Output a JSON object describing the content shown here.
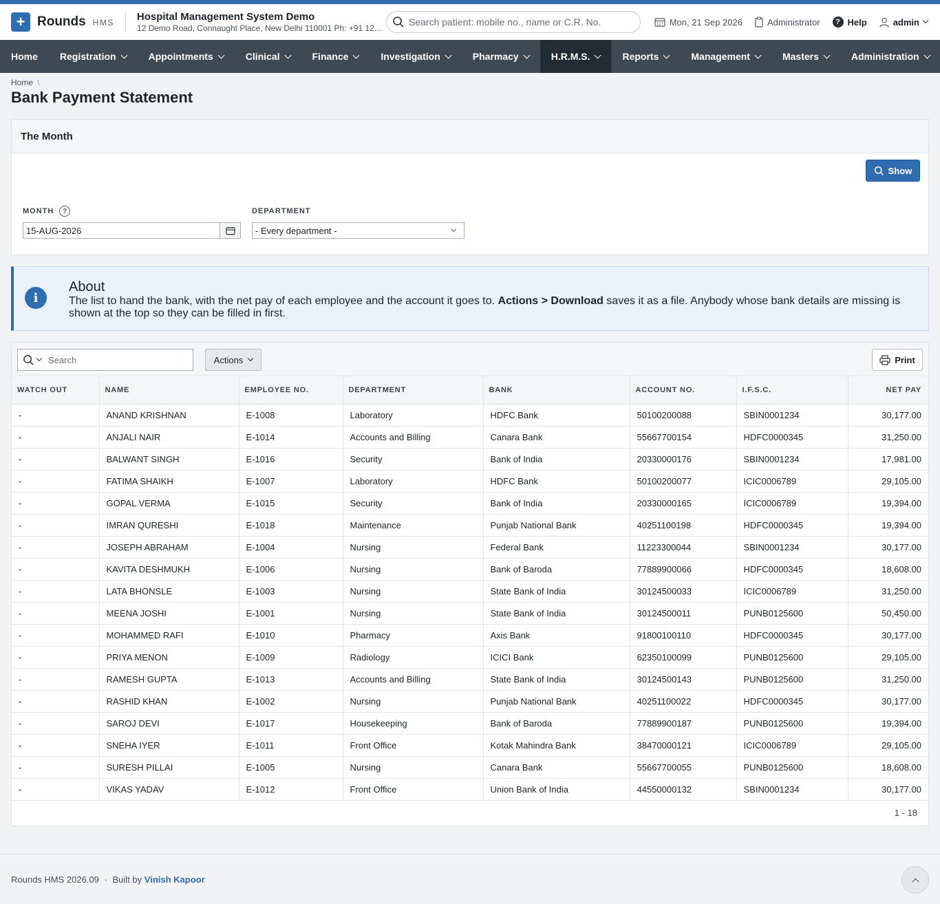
{
  "app": {
    "brand": "Rounds",
    "brand_sub": "HMS",
    "hospital_name": "Hospital Management System Demo",
    "hospital_address": "12 Demo Road, Connaught Place, New Delhi 110001 Ph: +91 123...",
    "search_placeholder": "Search patient: mobile no., name or C.R. No.",
    "date": "Mon, 21 Sep 2026",
    "role": "Administrator",
    "help": "Help",
    "user": "admin"
  },
  "nav": [
    {
      "label": "Home",
      "dropdown": false
    },
    {
      "label": "Registration",
      "dropdown": true
    },
    {
      "label": "Appointments",
      "dropdown": true
    },
    {
      "label": "Clinical",
      "dropdown": true
    },
    {
      "label": "Finance",
      "dropdown": true
    },
    {
      "label": "Investigation",
      "dropdown": true
    },
    {
      "label": "Pharmacy",
      "dropdown": true
    },
    {
      "label": "H.R.M.S.",
      "dropdown": true,
      "active": true
    },
    {
      "label": "Reports",
      "dropdown": true
    },
    {
      "label": "Management",
      "dropdown": true
    },
    {
      "label": "Masters",
      "dropdown": true
    },
    {
      "label": "Administration",
      "dropdown": true
    }
  ],
  "breadcrumb": {
    "home": "Home",
    "sep": "\\"
  },
  "page": {
    "title": "Bank Payment Statement"
  },
  "filter": {
    "panel_title": "The Month",
    "show_label": "Show",
    "month_label": "MONTH",
    "month_value": "15-AUG-2026",
    "department_label": "DEPARTMENT",
    "department_value": "- Every department -"
  },
  "about": {
    "title": "About",
    "text_before": "The list to hand the bank, with the net pay of each employee and the account it goes to. ",
    "text_bold": "Actions > Download",
    "text_after": " saves it as a file. Anybody whose bank details are missing is shown at the top so they can be filled in first."
  },
  "grid": {
    "search_placeholder": "Search",
    "actions_label": "Actions",
    "print_label": "Print",
    "columns": [
      "WATCH OUT",
      "NAME",
      "EMPLOYEE NO.",
      "DEPARTMENT",
      "BANK",
      "ACCOUNT NO.",
      "I.F.S.C.",
      "NET PAY"
    ],
    "rows": [
      [
        "-",
        "ANAND KRISHNAN",
        "E-1008",
        "Laboratory",
        "HDFC Bank",
        "50100200088",
        "SBIN0001234",
        "30,177.00"
      ],
      [
        "-",
        "ANJALI NAIR",
        "E-1014",
        "Accounts and Billing",
        "Canara Bank",
        "55667700154",
        "HDFC0000345",
        "31,250.00"
      ],
      [
        "-",
        "BALWANT SINGH",
        "E-1016",
        "Security",
        "Bank of India",
        "20330000176",
        "SBIN0001234",
        "17,981.00"
      ],
      [
        "-",
        "FATIMA SHAIKH",
        "E-1007",
        "Laboratory",
        "HDFC Bank",
        "50100200077",
        "ICIC0006789",
        "29,105.00"
      ],
      [
        "-",
        "GOPAL VERMA",
        "E-1015",
        "Security",
        "Bank of India",
        "20330000165",
        "ICIC0006789",
        "19,394.00"
      ],
      [
        "-",
        "IMRAN QURESHI",
        "E-1018",
        "Maintenance",
        "Punjab National Bank",
        "40251100198",
        "HDFC0000345",
        "19,394.00"
      ],
      [
        "-",
        "JOSEPH ABRAHAM",
        "E-1004",
        "Nursing",
        "Federal Bank",
        "11223300044",
        "SBIN0001234",
        "30,177.00"
      ],
      [
        "-",
        "KAVITA DESHMUKH",
        "E-1006",
        "Nursing",
        "Bank of Baroda",
        "77889900066",
        "HDFC0000345",
        "18,608.00"
      ],
      [
        "-",
        "LATA BHONSLE",
        "E-1003",
        "Nursing",
        "State Bank of India",
        "30124500033",
        "ICIC0006789",
        "31,250.00"
      ],
      [
        "-",
        "MEENA JOSHI",
        "E-1001",
        "Nursing",
        "State Bank of India",
        "30124500011",
        "PUNB0125600",
        "50,450.00"
      ],
      [
        "-",
        "MOHAMMED RAFI",
        "E-1010",
        "Pharmacy",
        "Axis Bank",
        "91800100110",
        "HDFC0000345",
        "30,177.00"
      ],
      [
        "-",
        "PRIYA MENON",
        "E-1009",
        "Radiology",
        "ICICI Bank",
        "62350100099",
        "PUNB0125600",
        "29,105.00"
      ],
      [
        "-",
        "RAMESH GUPTA",
        "E-1013",
        "Accounts and Billing",
        "State Bank of India",
        "30124500143",
        "PUNB0125600",
        "31,250.00"
      ],
      [
        "-",
        "RASHID KHAN",
        "E-1002",
        "Nursing",
        "Punjab National Bank",
        "40251100022",
        "HDFC0000345",
        "30,177.00"
      ],
      [
        "-",
        "SAROJ DEVI",
        "E-1017",
        "Housekeeping",
        "Bank of Baroda",
        "77889900187",
        "PUNB0125600",
        "19,394.00"
      ],
      [
        "-",
        "SNEHA IYER",
        "E-1011",
        "Front Office",
        "Kotak Mahindra Bank",
        "38470000121",
        "ICIC0006789",
        "29,105.00"
      ],
      [
        "-",
        "SURESH PILLAI",
        "E-1005",
        "Nursing",
        "Canara Bank",
        "55667700055",
        "PUNB0125600",
        "18,608.00"
      ],
      [
        "-",
        "VIKAS YADAV",
        "E-1012",
        "Front Office",
        "Union Bank of India",
        "44550000132",
        "SBIN0001234",
        "30,177.00"
      ]
    ],
    "pager": "1 - 18"
  },
  "footer": {
    "version": "Rounds HMS 2026.09",
    "dot": "·",
    "built_by": "Built by",
    "author": "Vinish Kapoor"
  },
  "icons": {
    "logo": "plus-icon",
    "search": "search-icon",
    "calendar": "calendar-icon",
    "clipboard": "clipboard-icon",
    "help": "help-icon",
    "user": "user-icon",
    "info": "info-icon",
    "print": "printer-icon",
    "top": "chevron-up-icon"
  },
  "colors": {
    "accent": "#2f6db0",
    "nav_bg": "#3d4954",
    "nav_active": "#232b33"
  }
}
